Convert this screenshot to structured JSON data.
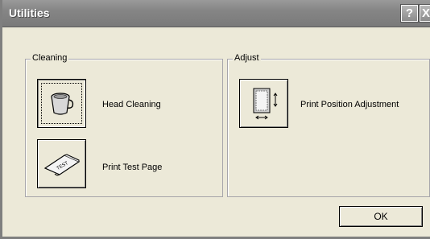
{
  "window": {
    "title": "Utilities",
    "help_glyph": "?",
    "close_glyph": "X"
  },
  "cleaning_group": {
    "legend": "Cleaning",
    "head_cleaning": {
      "label": "Head Cleaning",
      "icon": "head-cleaning-icon"
    },
    "print_test_page": {
      "label": "Print Test Page",
      "icon": "test-page-icon",
      "icon_text": "TEST"
    }
  },
  "adjust_group": {
    "legend": "Adjust",
    "print_position": {
      "label": "Print Position Adjustment",
      "icon": "print-position-icon"
    }
  },
  "footer": {
    "ok_label": "OK"
  }
}
